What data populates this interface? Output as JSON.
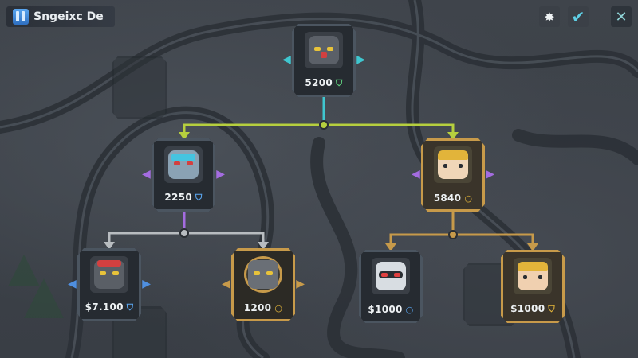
{
  "header": {
    "title": "Sngeixc De",
    "tools": {
      "spark_icon": "spark-icon",
      "check_icon": "check-icon",
      "close_icon": "close-icon"
    }
  },
  "colors": {
    "teal": "#3fc6cf",
    "green_line": "#b6cf3e",
    "purple": "#a46ce0",
    "gold": "#c79a4a",
    "blue": "#4f8fe0",
    "gray_line": "#b8bcc0"
  },
  "tree": {
    "root": {
      "cost": "5200",
      "currency_icon": "shield-icon",
      "portrait": "dark-robot-red-eyes"
    },
    "left": {
      "cost": "2250",
      "currency_icon": "shield-icon",
      "portrait": "blue-gray-helmet-robot"
    },
    "right": {
      "cost": "5840",
      "currency_icon": "coin-icon",
      "portrait": "golden-helmet-hero"
    },
    "left_left": {
      "cost": "$7.100",
      "currency_icon": "shield-icon",
      "portrait": "heavy-robot-yellow-eyes"
    },
    "left_right": {
      "cost": "1200",
      "currency_icon": "coin-icon",
      "portrait": "ornate-gold-robot"
    },
    "right_left": {
      "cost": "$1000",
      "currency_icon": "coin-icon",
      "portrait": "red-visor-robot"
    },
    "right_right": {
      "cost": "$1000",
      "currency_icon": "shield-icon",
      "portrait": "golden-helmet-hero"
    }
  }
}
